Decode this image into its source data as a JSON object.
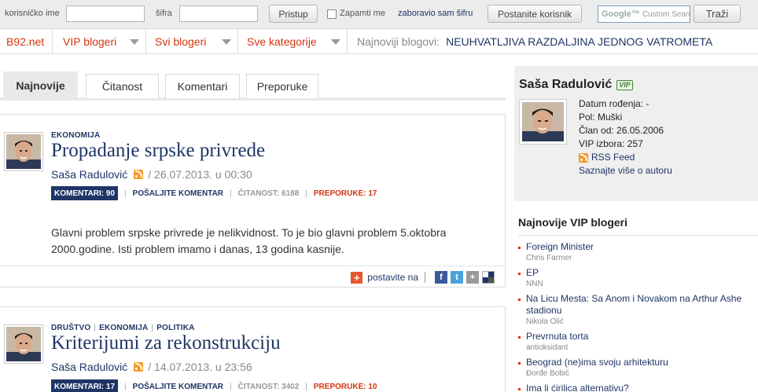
{
  "login": {
    "username_label": "korisničko ime",
    "password_label": "šifra",
    "login_button": "Pristup",
    "remember_label": "Zapamti me",
    "forgot_link": "zaboravio sam šifru",
    "register_button": "Postanite korisnik",
    "search_google": "Google™",
    "search_placeholder": "Custom Search",
    "search_button": "Traži"
  },
  "nav": {
    "items": [
      "B92.net",
      "VIP blogeri",
      "Svi blogeri",
      "Sve kategorije"
    ],
    "latest_label": "Najnoviji blogovi:",
    "latest_title": "NEUHVATLJIVA RAZDALJINA JEDNOG VATROMETA"
  },
  "tabs": [
    "Najnovije",
    "Čitanost",
    "Komentari",
    "Preporuke"
  ],
  "posts": [
    {
      "categories": [
        "EKONOMIJA"
      ],
      "title": "Propadanje srpske privrede",
      "author": "Saša Radulović",
      "date": "/ 26.07.2013. u 00:30",
      "comments": "KOMENTARI: 90",
      "send_comment": "POŠALJITE KOMENTAR",
      "reads": "ČITANOST: 6188",
      "recommend": "PREPORUKE: 17",
      "excerpt": "Glavni problem srpske privrede je nelikvidnost. To je bio glavni problem 5.oktobra 2000.godine. Isti problem imamo i danas, 13 godina kasnije.",
      "share_label": "postavite na"
    },
    {
      "cat1": "DRUŠTVO",
      "cat2": "EKONOMIJA",
      "cat3": "POLITIKA",
      "title": "Kriterijumi za rekonstrukciju",
      "author": "Saša Radulović",
      "date": "/ 14.07.2013. u 23:56",
      "comments": "KOMENTARI: 17",
      "send_comment": "POŠALJITE KOMENTAR",
      "reads": "ČITANOST: 3402",
      "recommend": "PREPORUKE: 10"
    }
  ],
  "profile": {
    "name": "Saša Radulović",
    "badge": "VIP",
    "birth": "Datum rođenja:  -",
    "sex": "Pol:  Muški",
    "member": "Član od:  26.05.2006",
    "vip_choices": "VIP izbora:  257",
    "rss": "RSS Feed",
    "more": "Saznajte više o autoru"
  },
  "vip_box": {
    "title": "Najnovije VIP blogeri",
    "items": [
      {
        "title": "Foreign Minister",
        "author": "Chris Farmer"
      },
      {
        "title": "EP",
        "author": "NNN"
      },
      {
        "title": "Na Licu Mesta: Sa Anom i Novakom na Arthur Ashe stadionu",
        "author": "Nikola Olić"
      },
      {
        "title": "Prevrnuta torta",
        "author": "antioksidant"
      },
      {
        "title": "Beograd (ne)ima svoju arhitekturu",
        "author": "Đorđe Bobić"
      },
      {
        "title": "Ima li ćirilica alternativu?",
        "author": ""
      }
    ]
  },
  "colors": {
    "accent_red": "#d4340f",
    "navy": "#1f3566",
    "grey_panel": "#efefef"
  }
}
